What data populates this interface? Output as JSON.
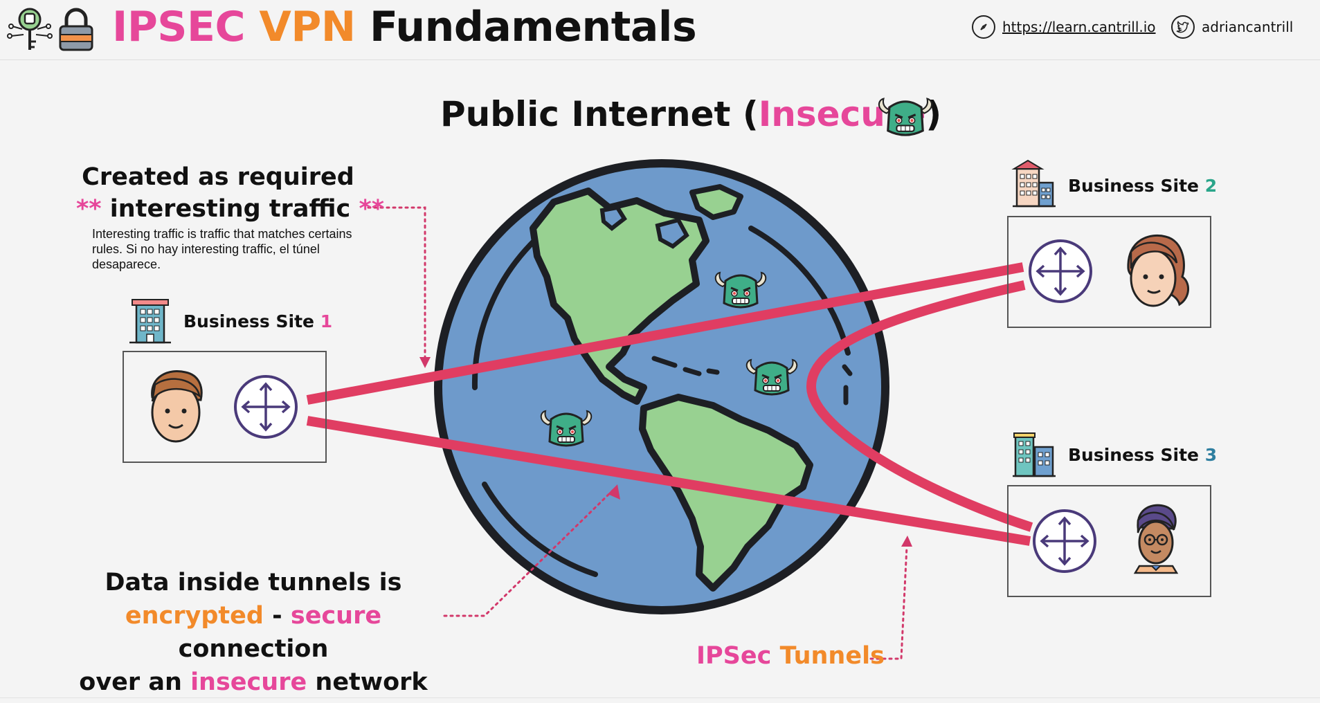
{
  "header": {
    "title_part1": "IPSEC",
    "title_part2": "VPN",
    "title_part3": "Fundamentals",
    "site_url": "https://learn.cantrill.io",
    "twitter_handle": "adriancantrill"
  },
  "diagram": {
    "title_prefix": "Public Internet (",
    "title_highlight": "Insecure",
    "title_suffix": ")",
    "interesting_traffic": {
      "line1": "Created as required",
      "line2_marks_left": "**",
      "line2_text": "interesting traffic",
      "line2_marks_right": "**",
      "description": "Interesting traffic is traffic that matches certains rules. Si no hay interesting traffic, el túnel desaparece."
    },
    "sites": [
      {
        "label": "Business Site",
        "number": "1"
      },
      {
        "label": "Business Site",
        "number": "2"
      },
      {
        "label": "Business Site",
        "number": "3"
      }
    ],
    "encryption_note": {
      "line1": "Data inside tunnels is",
      "encrypted": "encrypted",
      "dash": "-",
      "secure": "secure",
      "connection": "connection",
      "over_an": "over an",
      "insecure": "insecure",
      "network": "network"
    },
    "tunnels_label_part1": "IPSec",
    "tunnels_label_part2": "Tunnels"
  },
  "colors": {
    "pink": "#e6479a",
    "orange": "#f28a2a",
    "tunnel": "#e03d62",
    "ocean": "#6e9acb",
    "land": "#98d191",
    "router": "#4a3a7a"
  },
  "icons": [
    "circuit-key-icon",
    "padlock-icon",
    "compass-icon",
    "twitter-bird-icon",
    "troll-monster-icon",
    "building-icon",
    "router-icon",
    "person-avatar-icon"
  ]
}
